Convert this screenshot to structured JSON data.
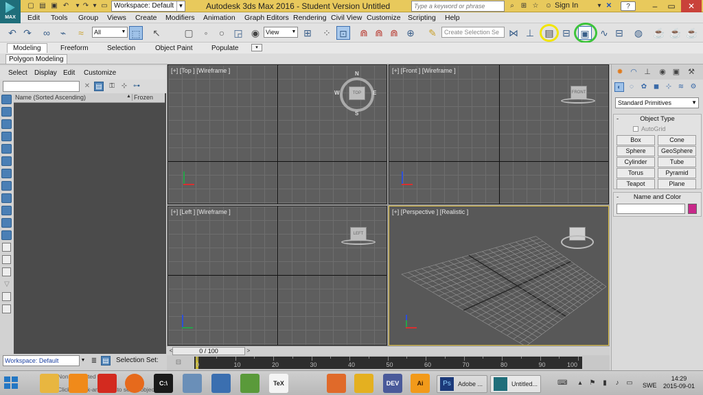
{
  "app": {
    "logo_text": "MAX",
    "title": "Autodesk 3ds Max 2016 - Student Version   Untitled",
    "workspace": "Workspace: Default",
    "search_placeholder": "Type a keyword or phrase",
    "signin": "Sign In",
    "help": "?"
  },
  "menu": [
    "Edit",
    "Tools",
    "Group",
    "Views",
    "Create",
    "Modifiers",
    "Animation",
    "Graph Editors",
    "Rendering",
    "Civil View",
    "Customize",
    "Scripting",
    "Help"
  ],
  "toolbar": {
    "selection_filter": "All",
    "ref_coord": "View",
    "selection_set_placeholder": "Create Selection Se",
    "highlight_yellow": "#f2e500",
    "highlight_green": "#3cc43a"
  },
  "ribbon": {
    "tabs": [
      "Modeling",
      "Freeform",
      "Selection",
      "Object Paint",
      "Populate"
    ],
    "active_tab": "Modeling",
    "subpanel": "Polygon Modeling"
  },
  "explorer": {
    "menu": [
      "Select",
      "Display",
      "Edit",
      "Customize"
    ],
    "col_name": "Name (Sorted Ascending)",
    "col_frozen": "Frozen",
    "sort_arrow": "▲"
  },
  "viewports": {
    "top": {
      "label": "[+] [Top ] [Wireframe ]",
      "cube": "TOP"
    },
    "front": {
      "label": "[+] [Front ] [Wireframe ]",
      "cube": "FRONT"
    },
    "left": {
      "label": "[+] [Left ] [Wireframe ]",
      "cube": "LEFT"
    },
    "perspective": {
      "label": "[+] [Perspective ] [Realistic ]"
    },
    "compass": {
      "n": "N",
      "s": "S",
      "e": "E",
      "w": "W"
    }
  },
  "timeline": {
    "frame": "0 / 100",
    "ticks": [
      "0",
      "10",
      "20",
      "30",
      "40",
      "50",
      "60",
      "70",
      "80",
      "90",
      "100"
    ]
  },
  "command_panel": {
    "category": "Standard Primitives",
    "object_type_title": "Object Type",
    "autogrid": "AutoGrid",
    "buttons": [
      "Box",
      "Cone",
      "Sphere",
      "GeoSphere",
      "Cylinder",
      "Tube",
      "Torus",
      "Pyramid",
      "Teapot",
      "Plane"
    ],
    "name_color_title": "Name and Color",
    "color": "#c8288a"
  },
  "status": {
    "workspace": "Workspace: Default",
    "selection_set": "Selection Set:",
    "none_selected": "None Selected",
    "prompt": "Click or click-and-drag to select objects"
  },
  "taskbar": {
    "apps": [
      {
        "name": "file-explorer",
        "label": ""
      },
      {
        "name": "vlc",
        "label": ""
      },
      {
        "name": "acrobat",
        "label": ""
      },
      {
        "name": "firefox",
        "label": ""
      },
      {
        "name": "terminal",
        "label": "C:\\"
      },
      {
        "name": "texmaker",
        "label": "TeX"
      },
      {
        "name": "matlab",
        "label": ""
      },
      {
        "name": "devc",
        "label": "DEV"
      },
      {
        "name": "illustrator",
        "label": "Ai"
      }
    ],
    "window1": "Adobe ...",
    "window2": "Untitled...",
    "lang": "SWE",
    "time": "14:29",
    "date": "2015-09-01"
  }
}
